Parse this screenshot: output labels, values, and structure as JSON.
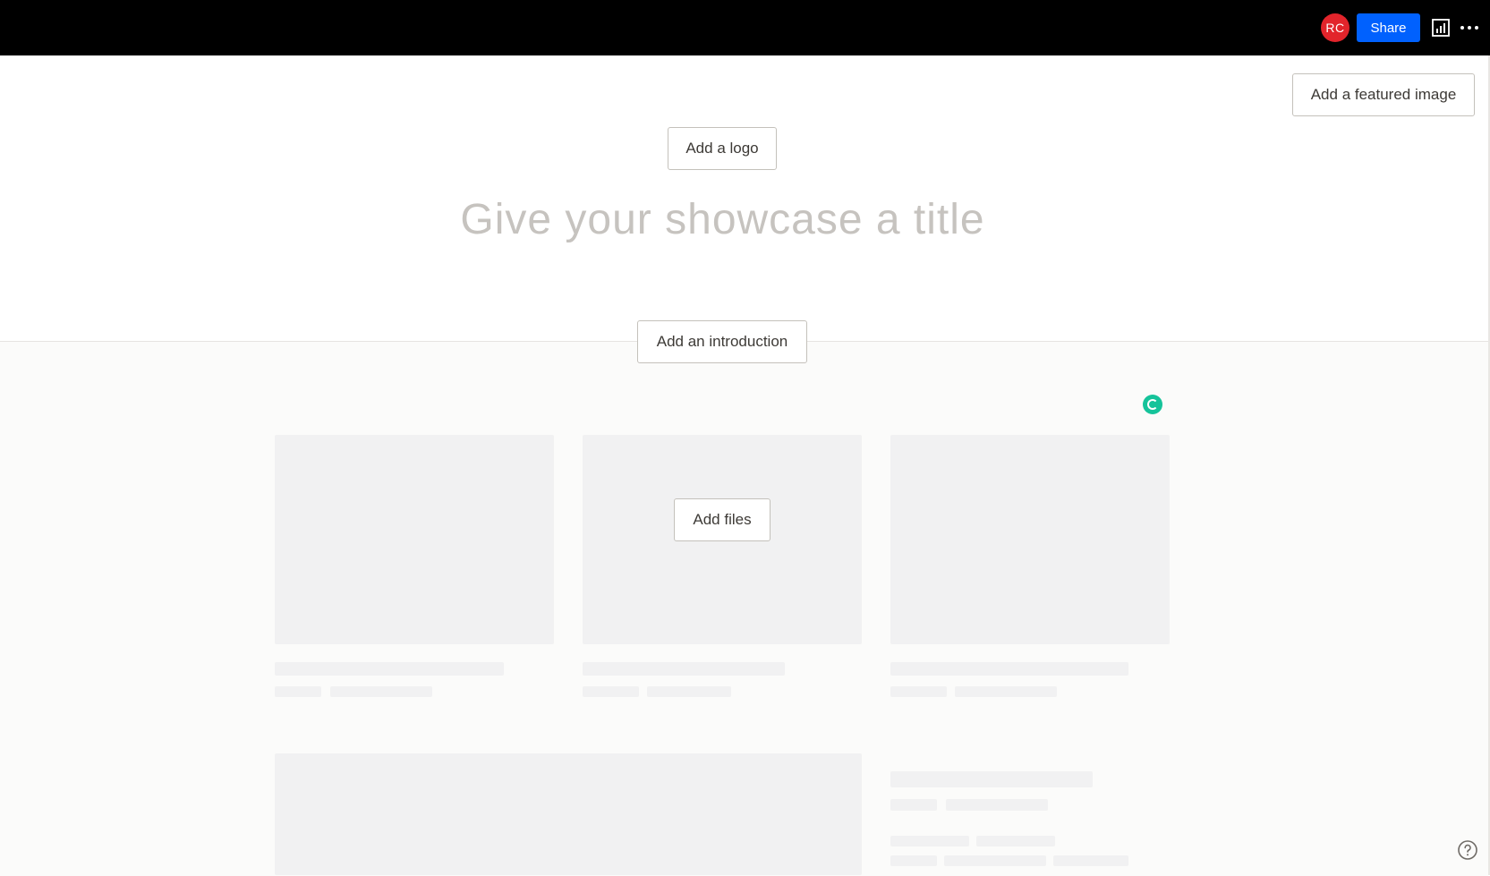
{
  "header": {
    "avatar_initials": "RC",
    "avatar_color": "#e2242b",
    "share_label": "Share",
    "share_color": "#0061fe",
    "icons": [
      "stats-icon",
      "more-options-icon"
    ]
  },
  "showcase": {
    "featured_image_label": "Add a featured image",
    "logo_label": "Add a logo",
    "title_placeholder": "Give your showcase a title",
    "introduction_label": "Add an introduction",
    "add_files_label": "Add files"
  },
  "extras": {
    "icons": [
      "grammarly-icon",
      "help-icon"
    ]
  }
}
